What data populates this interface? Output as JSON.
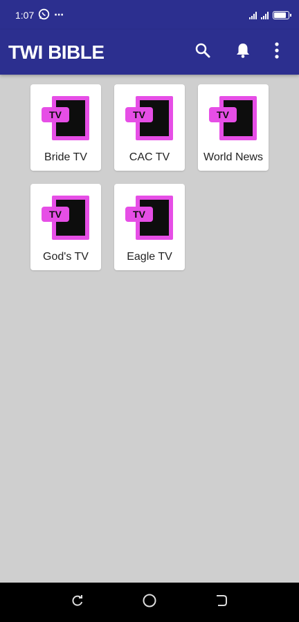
{
  "status_bar": {
    "time": "1:07",
    "notification_icons": [
      "whatsapp-icon",
      "more-dots-icon"
    ],
    "dots": "⋯",
    "battery_level": 0.85
  },
  "app_bar": {
    "title": "TWI BIBLE",
    "actions": [
      "search-icon",
      "bell-icon",
      "overflow-menu-icon"
    ]
  },
  "channels": [
    {
      "label": "Bride TV",
      "icon": "tv-icon"
    },
    {
      "label": "CAC TV",
      "icon": "tv-icon"
    },
    {
      "label": "World News",
      "icon": "tv-icon"
    },
    {
      "label": "God's TV",
      "icon": "tv-icon"
    },
    {
      "label": "Eagle TV",
      "icon": "tv-icon"
    }
  ],
  "tv_icon_text": "TV",
  "colors": {
    "primary": "#2c2f8f",
    "background": "#cfcfcf",
    "icon_accent": "#e64ee6",
    "icon_dark": "#0d0d0d"
  },
  "nav_bar": {
    "buttons": [
      "recent-apps-icon",
      "home-icon",
      "back-icon"
    ]
  }
}
